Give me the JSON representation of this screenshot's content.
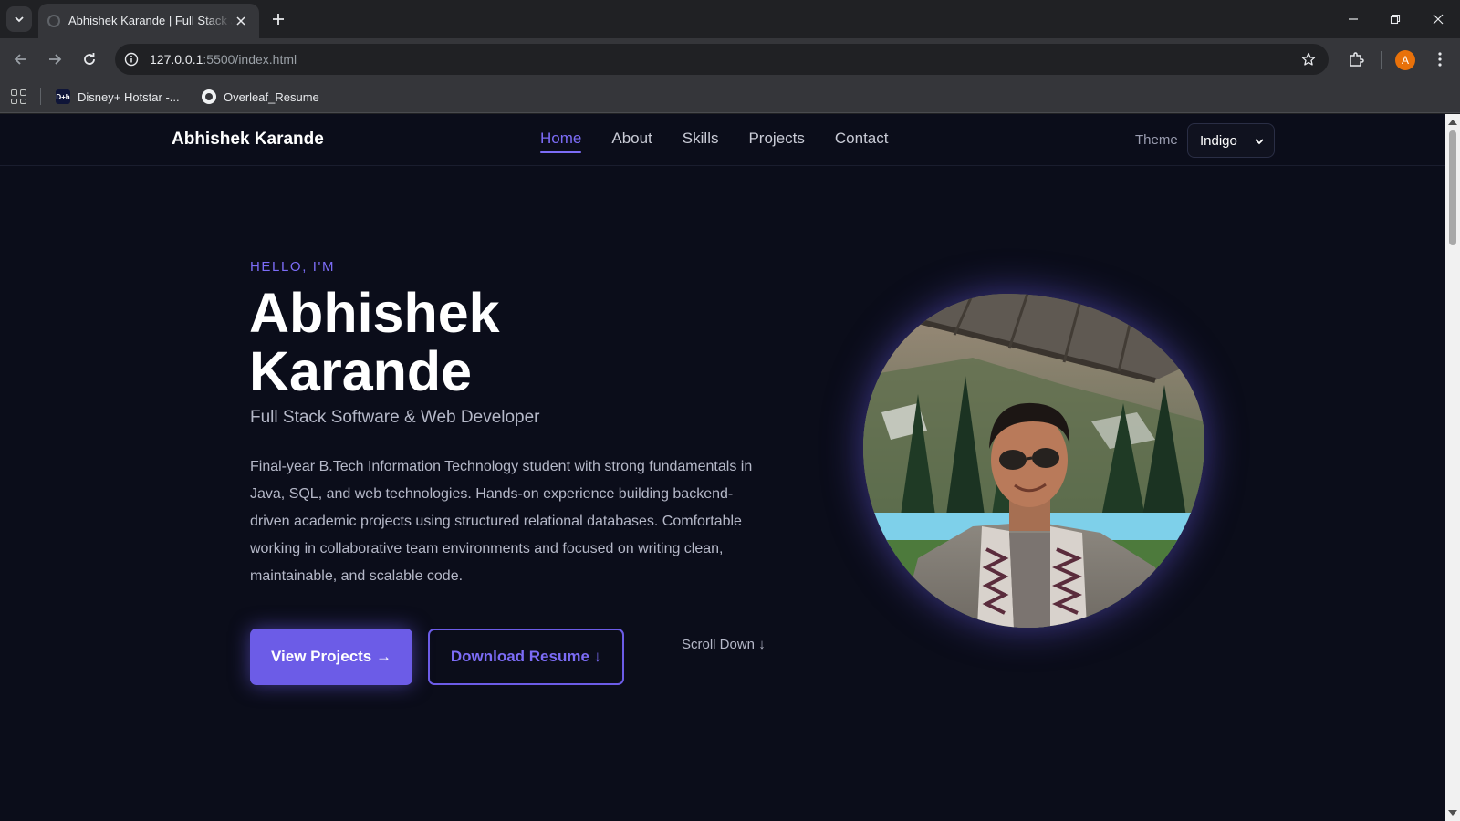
{
  "browser": {
    "tab_title": "Abhishek Karande | Full Stack Java Developer",
    "url_host": "127.0.0.1",
    "url_rest": ":5500/index.html",
    "bookmarks": [
      "Disney+ Hotstar -...",
      "Overleaf_Resume"
    ],
    "hotstar_icon_text": "D+h",
    "profile_initial": "A"
  },
  "header": {
    "brand": "Abhishek Karande",
    "nav": [
      {
        "label": "Home",
        "active": true
      },
      {
        "label": "About"
      },
      {
        "label": "Skills"
      },
      {
        "label": "Projects"
      },
      {
        "label": "Contact"
      }
    ],
    "theme_label": "Theme",
    "theme_value": "Indigo"
  },
  "hero": {
    "eyebrow": "HELLO, I'M",
    "name_line1": "Abhishek",
    "name_line2": "Karande",
    "role": "Full Stack Software & Web Developer",
    "bio": "Final-year B.Tech Information Technology student with strong fundamentals in Java, SQL, and web technologies. Hands-on experience building backend-driven academic projects using structured relational databases. Comfortable working in collaborative team environments and focused on writing clean, maintainable, and scalable code.",
    "primary_button": "View Projects →",
    "secondary_button": "Download Resume ↓",
    "scroll_hint": "Scroll Down ↓"
  },
  "colors": {
    "accent": "#6c5ce7",
    "page_bg": "#0b0d1a"
  }
}
